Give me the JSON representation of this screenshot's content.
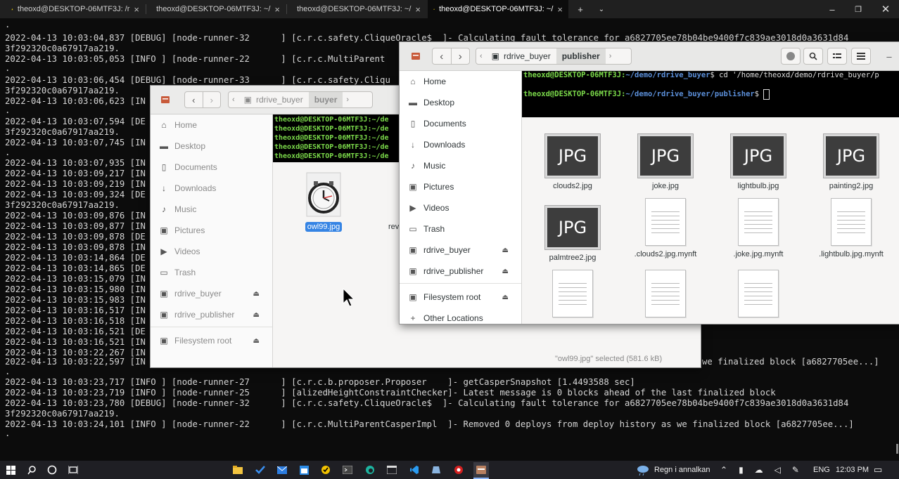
{
  "tabs": [
    {
      "label": "theoxd@DESKTOP-06MTF3J: /r",
      "active": false
    },
    {
      "label": "theoxd@DESKTOP-06MTF3J: ~/",
      "active": false
    },
    {
      "label": "theoxd@DESKTOP-06MTF3J: ~/",
      "active": false
    },
    {
      "label": "theoxd@DESKTOP-06MTF3J: ~/",
      "active": true
    }
  ],
  "terminal": {
    "lines": [
      ".",
      "2022-04-13 10:03:04,837 [DEBUG] [node-runner-32      ] [c.r.c.safety.CliqueOracle$  ]- Calculating fault tolerance for a6827705ee78b04be9400f7c839ae3018d0a3631d84",
      "3f292320c0a67917aa219.",
      "2022-04-13 10:03:05,053 [INFO ] [node-runner-22      ] [c.r.c.MultiParent",
      ".",
      "2022-04-13 10:03:06,454 [DEBUG] [node-runner-33      ] [c.r.c.safety.Cliqu",
      "3f292320c0a67917aa219.",
      "2022-04-13 10:03:06,623 [IN",
      ".",
      "2022-04-13 10:03:07,594 [DE",
      "3f292320c0a67917aa219.",
      "2022-04-13 10:03:07,745 [IN",
      ".",
      "2022-04-13 10:03:07,935 [IN",
      "2022-04-13 10:03:09,217 [IN",
      "2022-04-13 10:03:09,219 [IN",
      "2022-04-13 10:03:09,324 [DE",
      "3f292320c0a67917aa219.",
      "2022-04-13 10:03:09,876 [IN",
      "2022-04-13 10:03:09,877 [IN",
      "2022-04-13 10:03:09,878 [DE",
      "2022-04-13 10:03:09,878 [IN",
      "2022-04-13 10:03:14,864 [DE",
      "2022-04-13 10:03:14,865 [DE",
      "2022-04-13 10:03:15,079 [IN",
      "2022-04-13 10:03:15,980 [IN",
      "2022-04-13 10:03:15,983 [IN",
      "2022-04-13 10:03:16,517 [IN",
      "2022-04-13 10:03:16,518 [IN",
      "2022-04-13 10:03:16,521 [DE",
      "2022-04-13 10:03:16,521 [IN",
      "2022-04-13 10:03:22,267 [IN",
      "2022-04-13 10:03:22,597 [IN",
      ".",
      "2022-04-13 10:03:23,717 [INFO ] [node-runner-27      ] [c.r.c.b.proposer.Proposer    ]- getCasperSnapshot [1.4493588 sec]",
      "2022-04-13 10:03:23,719 [INFO ] [node-runner-25      ] [alizedHeightConstraintChecker]- Latest message is 0 blocks ahead of the last finalized block",
      "2022-04-13 10:03:23,780 [DEBUG] [node-runner-32      ] [c.r.c.safety.CliqueOracle$  ]- Calculating fault tolerance for a6827705ee78b04be9400f7c839ae3018d0a3631d84",
      "3f292320c0a67917aa219.",
      "2022-04-13 10:03:24,101 [INFO ] [node-runner-22      ] [c.r.c.MultiParentCasperImpl  ]- Removed 0 deploys from deploy history as we finalized block [a6827705ee...]",
      "."
    ],
    "tail_fragment": "we finalized block [a6827705ee...]"
  },
  "sidebar_items": [
    {
      "label": "Home",
      "icon": "home-icon"
    },
    {
      "label": "Desktop",
      "icon": "desktop-icon"
    },
    {
      "label": "Documents",
      "icon": "documents-icon"
    },
    {
      "label": "Downloads",
      "icon": "downloads-icon"
    },
    {
      "label": "Music",
      "icon": "music-icon"
    },
    {
      "label": "Pictures",
      "icon": "pictures-icon"
    },
    {
      "label": "Videos",
      "icon": "videos-icon"
    },
    {
      "label": "Trash",
      "icon": "trash-icon"
    },
    {
      "label": "rdrive_buyer",
      "icon": "drive-icon",
      "eject": true
    },
    {
      "label": "rdrive_publisher",
      "icon": "drive-icon",
      "eject": true
    },
    {
      "label": "Filesystem root",
      "icon": "drive-icon",
      "eject": true
    }
  ],
  "buyer_window": {
    "crumbs": [
      "rdrive_buyer",
      "buyer"
    ],
    "file_selected": "owl99.jpg",
    "file_partial": "rev",
    "status": "\"owl99.jpg\" selected (581.6 kB)",
    "embedded_terminal": [
      "theoxd@DESKTOP-06MTF3J:~/de",
      "theoxd@DESKTOP-06MTF3J:~/de",
      "theoxd@DESKTOP-06MTF3J:~/de",
      "theoxd@DESKTOP-06MTF3J:~/de",
      "theoxd@DESKTOP-06MTF3J:~/de"
    ]
  },
  "publisher_window": {
    "crumbs": [
      "rdrive_buyer",
      "publisher"
    ],
    "other_locations": "Other Locations",
    "terminal_lines": [
      {
        "prompt": "theoxd@DESKTOP-06MTF3J:",
        "path": "~/demo/rdrive_buyer",
        "cmd": "$  cd '/home/theoxd/demo/rdrive_buyer/p"
      },
      {
        "prompt": "theoxd@DESKTOP-06MTF3J:",
        "path": "~/demo/rdrive_buyer/publisher",
        "cmd": "$ "
      }
    ],
    "files": [
      {
        "name": "clouds2.jpg",
        "kind": "jpg"
      },
      {
        "name": "joke.jpg",
        "kind": "jpg"
      },
      {
        "name": "lightbulb.jpg",
        "kind": "jpg"
      },
      {
        "name": "painting2.jpg",
        "kind": "jpg"
      },
      {
        "name": "palmtree2.jpg",
        "kind": "jpg"
      },
      {
        "name": ".clouds2.jpg.mynft",
        "kind": "doc"
      },
      {
        "name": ".joke.jpg.mynft",
        "kind": "doc"
      },
      {
        "name": ".lightbulb.jpg.mynft",
        "kind": "doc"
      },
      {
        "name": "",
        "kind": "doc"
      },
      {
        "name": "",
        "kind": "doc"
      },
      {
        "name": "",
        "kind": "doc"
      }
    ],
    "jpg_badge": "JPG"
  },
  "taskbar": {
    "weather": "Regn i annalkan",
    "lang": "ENG",
    "time": "12:03 PM"
  }
}
